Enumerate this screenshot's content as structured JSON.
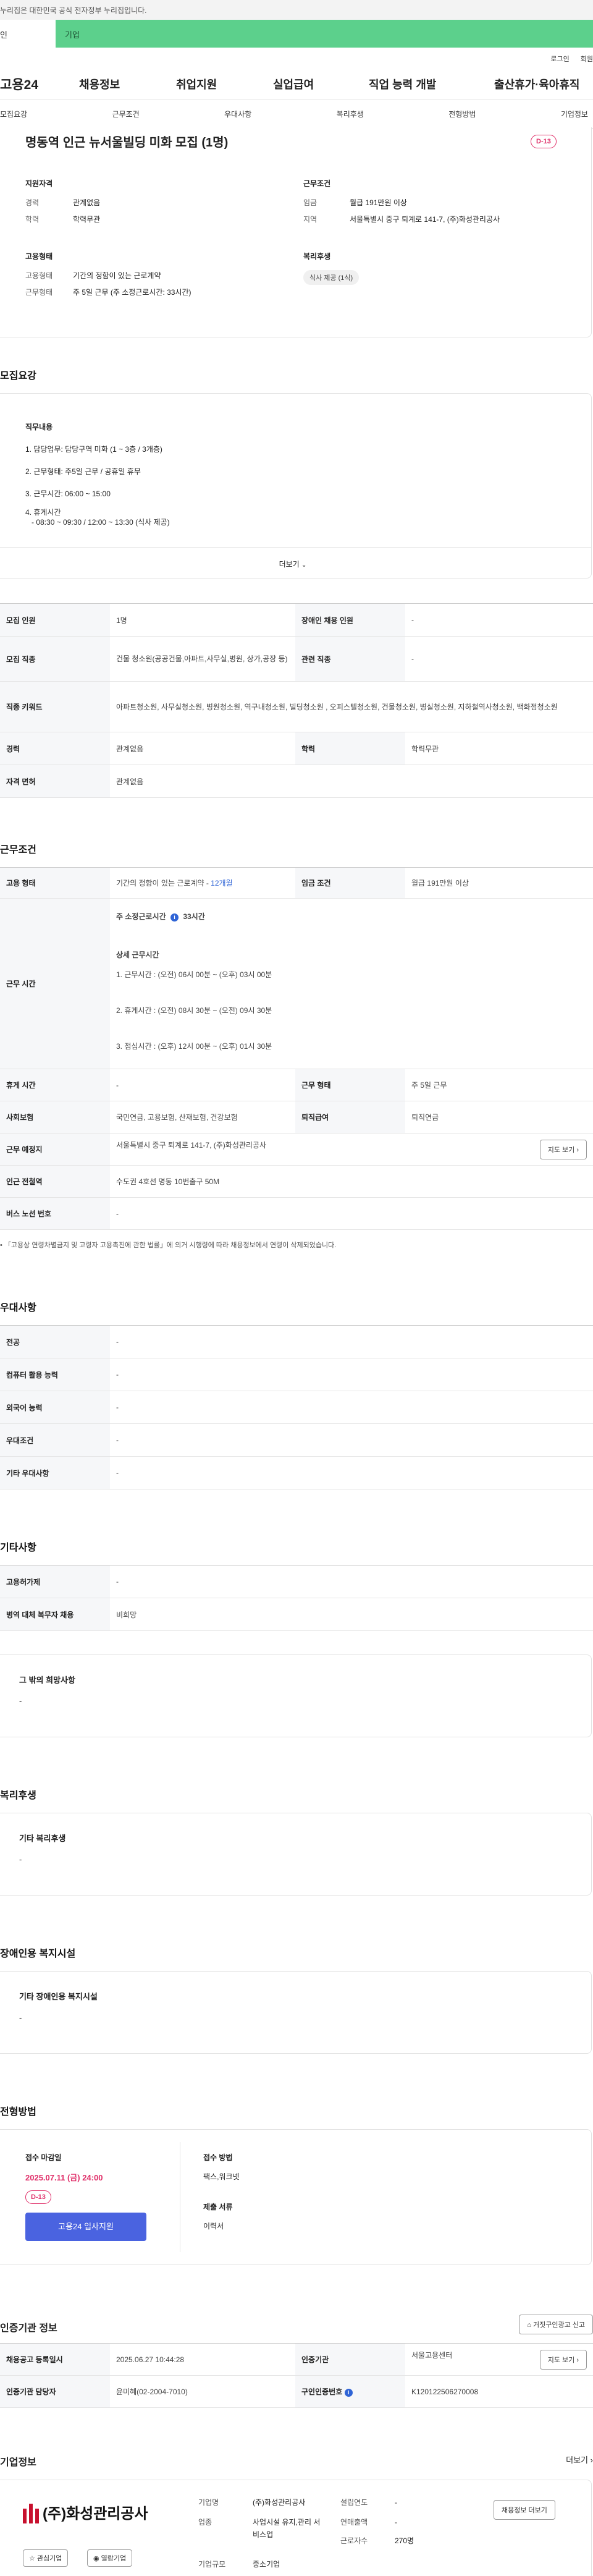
{
  "gov_bar": {
    "text": "누리집은 대한민국 공식 전자정부 누리집입니다."
  },
  "top_tabs": {
    "personal": "인",
    "company": "기업"
  },
  "util": {
    "login": "로그인",
    "join": "회원"
  },
  "gnb": {
    "logo": "고용24",
    "items": [
      "채용정보",
      "취업지원",
      "실업급여",
      "직업 능력 개발",
      "출산휴가·육아휴직"
    ]
  },
  "lnb": {
    "items": [
      "모집요강",
      "근무조건",
      "우대사항",
      "복리후생",
      "전형방법",
      "기업정보"
    ]
  },
  "summary": {
    "title": "명동역 인근 뉴서울빌딩 미화 모집 (1명)",
    "dday": "D-13",
    "qual_label": "지원자격",
    "career_k": "경력",
    "career_v": "관계없음",
    "edu_k": "학력",
    "edu_v": "학력무관",
    "cond_label": "근무조건",
    "wage_k": "임금",
    "wage_v": "월급 191만원 이상",
    "loc_k": "지역",
    "loc_v": "서울특별시 중구 퇴계로 141-7, (주)화성관리공사",
    "emp_label": "고용형태",
    "emp_k": "고용형태",
    "emp_v": "기간의 정함이 있는 근로계약",
    "worktype_k": "근무형태",
    "worktype_v": "주 5일 근무 (주 소정근로시간: 33시간)",
    "welfare_label": "복리후생",
    "welfare_v": "식사 제공 (1식)"
  },
  "recruit": {
    "section_title": "모집요강",
    "job_label": "직무내용",
    "lines": [
      "1. 담당업무: 담당구역 미화 (1 ~ 3층 / 3개층)",
      "2. 근무형태: 주5일 근무 / 공휴일 휴무",
      "3. 근무시간: 06:00 ~ 15:00",
      "4. 휴게시간",
      "   - 08:30 ~ 09:30 / 12:00 ~ 13:30 (식사 제공)"
    ],
    "more": "더보기"
  },
  "recruit_table": {
    "headcount_h": "모집 인원",
    "headcount_v": "1명",
    "disabled_h": "장애인 채용 인원",
    "disabled_v": "-",
    "occupation_h": "모집 직종",
    "occupation_v": "건물 청소원(공공건물,아파트,사무실,병원, 상가,공장 등)",
    "related_h": "관련 직종",
    "related_v": "-",
    "keyword_h": "직종 키워드",
    "keyword_v": "아파트청소원, 사무실청소원, 병원청소원, 역구내청소원, 빌딩청소원 , 오피스텔청소원, 건물청소원, 병실청소원, 지하철역사청소원, 백화점청소원",
    "career_h": "경력",
    "career_v": "관계없음",
    "edu_h": "학력",
    "edu_v": "학력무관",
    "license_h": "자격 면허",
    "license_v": "관계없음"
  },
  "work": {
    "section_title": "근무조건",
    "emp_h": "고용 형태",
    "emp_v": "기간의 정함이 있는 근로계약 - ",
    "emp_v_link": "12개월",
    "wage_h": "임금 조건",
    "wage_v": "월급 191만원 이상",
    "hours_h": "근무 시간",
    "weekly": "주 소정근로시간",
    "weekly_v": "33시간",
    "detail_label": "상세 근무시간",
    "detail": [
      "1. 근무시간 : (오전) 06시 00분 ~ (오후) 03시 00분",
      "2. 휴게시간 : (오전) 08시 30분 ~ (오전) 09시 30분",
      "3. 점심시간 : (오후) 12시 00분 ~ (오후) 01시 30분"
    ],
    "rest_h": "휴게 시간",
    "rest_v": "-",
    "worktype_h": "근무 형태",
    "worktype_v": "주 5일 근무",
    "insurance_h": "사회보험",
    "insurance_v": "국민연금, 고용보험, 산재보험, 건강보험",
    "severance_h": "퇴직급여",
    "severance_v": "퇴직연금",
    "place_h": "근무 예정지",
    "place_v": "서울특별시 중구 퇴계로 141-7, (주)화성관리공사",
    "map_btn": "지도 보기",
    "subway_h": "인근 전철역",
    "subway_v": "수도권 4호선 명동 10번출구 50M",
    "bus_h": "버스 노선 번호",
    "bus_v": "-",
    "note": "「고용상 연령차별금지 및 고령자 고용촉진에 관한 법률」에 의거 시행령에 따라 채용정보에서 연령이 삭제되었습니다."
  },
  "pref": {
    "section_title": "우대사항",
    "rows": [
      {
        "h": "전공",
        "v": "-"
      },
      {
        "h": "컴퓨터 활용 능력",
        "v": "-"
      },
      {
        "h": "외국어 능력",
        "v": "-"
      },
      {
        "h": "우대조건",
        "v": "-"
      },
      {
        "h": "기타 우대사항",
        "v": "-"
      }
    ]
  },
  "etc": {
    "section_title": "기타사항",
    "rows": [
      {
        "h": "고용허가제",
        "v": "-"
      },
      {
        "h": "병역 대체 복무자 채용",
        "v": "비희망"
      }
    ],
    "other_label": "그 밖의 희망사항",
    "other_v": "-"
  },
  "welfare": {
    "section_title": "복리후생",
    "label": "기타 복리후생",
    "value": "-"
  },
  "disabled_fac": {
    "section_title": "장애인용 복지시설",
    "label": "기타 장애인용 복지시설",
    "value": "-"
  },
  "selection": {
    "section_title": "전형방법",
    "deadline_label": "접수 마감일",
    "deadline_v": "2025.07.11 (금) 24:00",
    "dday": "D-13",
    "apply_btn": "고용24 입사지원",
    "method_label": "접수 방법",
    "method_v": "팩스,워크넷",
    "docs_label": "제출 서류",
    "docs_v": "이력서"
  },
  "cert": {
    "section_title": "인증기관 정보",
    "report_btn": "거짓구인광고 신고",
    "reg_h": "채용공고 등록일시",
    "reg_v": "2025.06.27 10:44:28",
    "org_h": "인증기관",
    "org_v": "서울고용센터",
    "map_btn": "지도 보기",
    "mgr_h": "인증기관 담당자",
    "mgr_v": "윤미혜(02-2004-7010)",
    "no_h": "구인인증번호",
    "no_v": "K120122506270008"
  },
  "company": {
    "section_title": "기업정보",
    "more": "더보기",
    "logo_text": "(주)화성관리공사",
    "name_k": "기업명",
    "name_v": "(주)화성관리공사",
    "founded_k": "설립연도",
    "founded_v": "-",
    "biz_k": "업종",
    "biz_v": "사업시설 유지,관리 서비스업",
    "revenue_k": "연매출액",
    "revenue_v": "-",
    "employees_k": "근로자수",
    "employees_v": "270명",
    "size_k": "기업규모",
    "size_v": "중소기업",
    "jobs_btn": "채용정보 더보기",
    "interest_btn": "관심기업",
    "visit_btn": "열람기업"
  }
}
